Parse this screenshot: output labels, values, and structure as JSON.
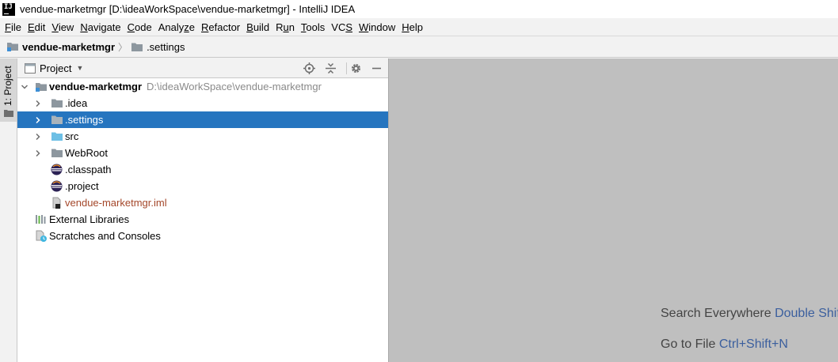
{
  "window": {
    "title": "vendue-marketmgr [D:\\ideaWorkSpace\\vendue-marketmgr] - IntelliJ IDEA",
    "logo_text": "IJ"
  },
  "menu": [
    {
      "mnemonic": "F",
      "rest": "ile"
    },
    {
      "mnemonic": "E",
      "rest": "dit"
    },
    {
      "mnemonic": "V",
      "rest": "iew"
    },
    {
      "mnemonic": "N",
      "rest": "avigate"
    },
    {
      "mnemonic": "C",
      "rest": "ode"
    },
    {
      "pre": "Analy",
      "mnemonic": "z",
      "rest": "e"
    },
    {
      "mnemonic": "R",
      "rest": "efactor"
    },
    {
      "mnemonic": "B",
      "rest": "uild"
    },
    {
      "pre": "R",
      "mnemonic": "u",
      "rest": "n"
    },
    {
      "mnemonic": "T",
      "rest": "ools"
    },
    {
      "pre": "VC",
      "mnemonic": "S",
      "rest": ""
    },
    {
      "mnemonic": "W",
      "rest": "indow"
    },
    {
      "mnemonic": "H",
      "rest": "elp"
    }
  ],
  "breadcrumb": {
    "project": "vendue-marketmgr",
    "folder": ".settings",
    "separator": "〉"
  },
  "tool_stripe": {
    "project_tab": "1: Project"
  },
  "project_panel": {
    "title": "Project",
    "tree": {
      "root": {
        "label": "vendue-marketmgr",
        "path": "D:\\ideaWorkSpace\\vendue-marketmgr"
      },
      "items": [
        {
          "label": ".idea",
          "icon": "folder-icon"
        },
        {
          "label": ".settings",
          "icon": "folder-icon",
          "selected": true
        },
        {
          "label": "src",
          "icon": "source-folder-icon"
        },
        {
          "label": "WebRoot",
          "icon": "folder-icon"
        },
        {
          "label": ".classpath",
          "icon": "eclipse-icon"
        },
        {
          "label": ".project",
          "icon": "eclipse-icon"
        },
        {
          "label": "vendue-marketmgr.iml",
          "icon": "module-file-icon"
        }
      ],
      "external_libraries": "External Libraries",
      "scratches": "Scratches and Consoles"
    }
  },
  "editor": {
    "search_everywhere_label": "Search Everywhere",
    "search_everywhere_key": "Double Shift",
    "goto_file_label": "Go to File",
    "goto_file_key": "Ctrl+Shift+N"
  },
  "colors": {
    "selection": "#2675bf",
    "folder": "#8d979f",
    "source_folder": "#6dbfe5",
    "iml_text": "#a4472a",
    "shortcut": "#3b5f9e"
  }
}
